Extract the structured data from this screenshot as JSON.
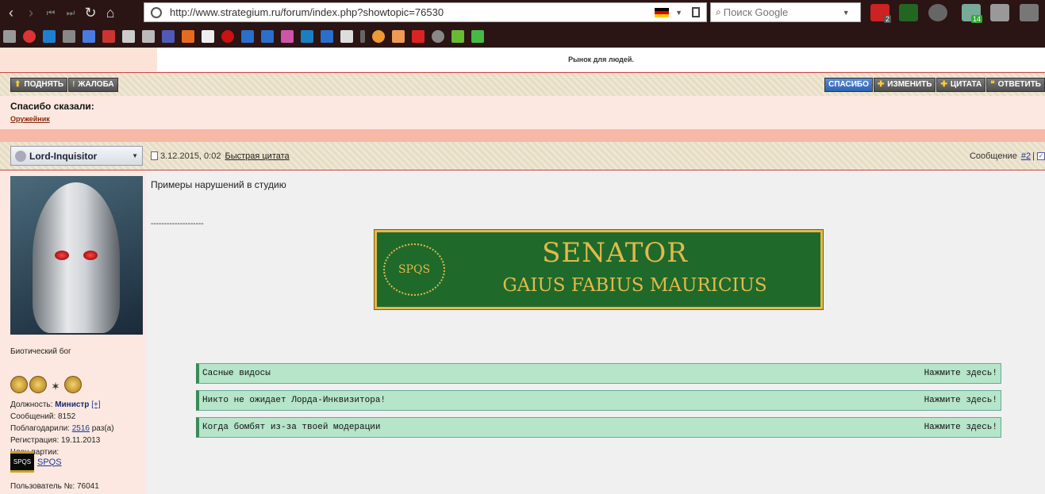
{
  "browser": {
    "url": "http://www.strategium.ru/forum/index.php?showtopic=76530",
    "search_placeholder": "Поиск Google",
    "ext_badges": [
      "2",
      "14"
    ]
  },
  "forum": {
    "top_message": "Рынок для людей.",
    "actions_left": [
      {
        "label": "ПОДНЯТЬ",
        "icon": "arrow-up-icon"
      },
      {
        "label": "ЖАЛОБА",
        "icon": "exclamation-icon"
      }
    ],
    "actions_right": [
      {
        "label": "СПАСИБО",
        "icon": ""
      },
      {
        "label": "ИЗМЕНИТЬ",
        "icon": "plus-icon"
      },
      {
        "label": "ЦИТАТА",
        "icon": "plus-icon"
      },
      {
        "label": "ОТВЕТИТЬ",
        "icon": "quote-icon"
      }
    ],
    "thanks_title": "Спасибо сказали:",
    "thanks_user": "Оружейник"
  },
  "post": {
    "author": "Lord-Inquisitor",
    "date": "3.12.2015, 0:02",
    "quick_quote": "Быстрая цитата",
    "msg_label": "Сообщение",
    "msg_number": "#2",
    "msg_sep": "|",
    "text": "Примеры нарушений в студию",
    "signature_sep": "--------------------",
    "banner": {
      "seal": "SPQS",
      "title": "SENATOR",
      "name": "GAIUS FABIUS MAURICIUS"
    },
    "spoilers": [
      {
        "title": "Сасные видосы",
        "action": "Нажмите здесь!"
      },
      {
        "title": "Никто не ожидает Лорда-Инквизитора!",
        "action": "Нажмите здесь!"
      },
      {
        "title": "Когда бомбят из-за твоей модерации",
        "action": "Нажмите здесь!"
      }
    ]
  },
  "profile": {
    "title": "Биотический бог",
    "position_label": "Должность:",
    "position": "Министр",
    "position_expand": "[+]",
    "messages": "Сообщений: 8152",
    "thanked_label": "Поблагодарили:",
    "thanked_count": "2516",
    "thanked_suffix": "раз(а)",
    "registration": "Регистрация: 19.11.2013",
    "party_label": "Член партии:",
    "party_logo": "SPQS",
    "party_name": "SPQS",
    "user_id": "Пользователь №: 76041"
  }
}
